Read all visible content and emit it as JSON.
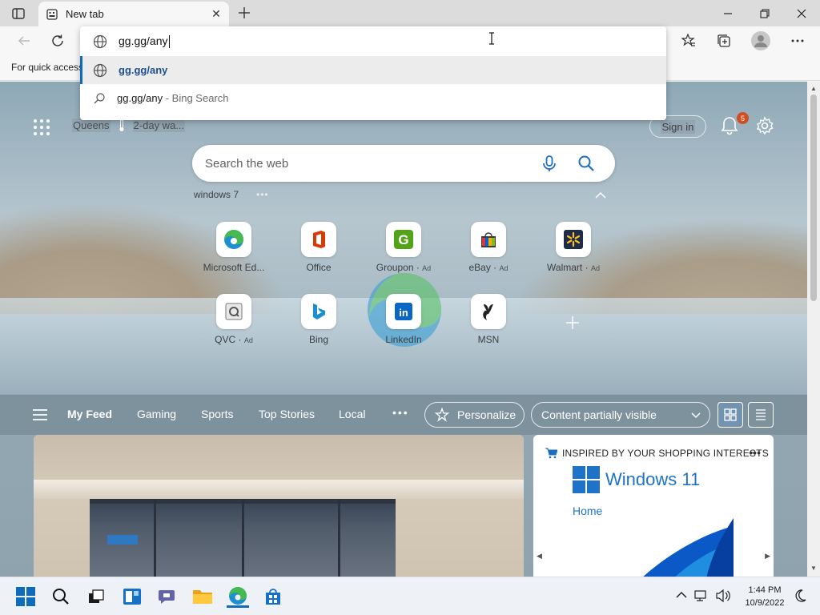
{
  "browser": {
    "tab_title": "New tab",
    "favorites_hint": "For quick access",
    "omnibox": {
      "typed_text": "gg.gg/any",
      "suggestions": [
        {
          "text": "gg.gg/any",
          "suffix": ""
        },
        {
          "text": "gg.gg/any",
          "suffix": " - Bing Search"
        }
      ]
    }
  },
  "ntp": {
    "weather": {
      "location": "Queens",
      "forecast": "2-day wa..."
    },
    "signin_label": "Sign in",
    "notification_count": "5",
    "search_placeholder": "Search the web",
    "trending": [
      "windows 7"
    ],
    "tiles": [
      {
        "label": "Microsoft Ed...",
        "ad": "",
        "icon": "edge-icon"
      },
      {
        "label": "Office",
        "ad": "",
        "icon": "office-icon"
      },
      {
        "label": "Groupon",
        "ad": "Ad",
        "icon": "groupon-icon"
      },
      {
        "label": "eBay",
        "ad": "Ad",
        "icon": "ebay-icon"
      },
      {
        "label": "Walmart",
        "ad": "Ad",
        "icon": "walmart-icon"
      },
      {
        "label": "QVC",
        "ad": "Ad",
        "icon": "qvc-icon"
      },
      {
        "label": "Bing",
        "ad": "",
        "icon": "bing-icon"
      },
      {
        "label": "LinkedIn",
        "ad": "",
        "icon": "linkedin-icon"
      },
      {
        "label": "MSN",
        "ad": "",
        "icon": "msn-icon"
      }
    ],
    "feed_tabs": [
      "My Feed",
      "Gaming",
      "Sports",
      "Top Stories",
      "Local"
    ],
    "personalize_label": "Personalize",
    "visibility_label": "Content partially visible",
    "shopping": {
      "heading": "INSPIRED BY YOUR SHOPPING INTERESTS",
      "product": "Windows 11",
      "link": "Home"
    }
  },
  "taskbar": {
    "time": "1:44 PM",
    "date": "10/9/2022"
  },
  "colors": {
    "accent": "#0f6cbd",
    "badge": "#d04e24",
    "windows_blue": "#1e73c8"
  }
}
